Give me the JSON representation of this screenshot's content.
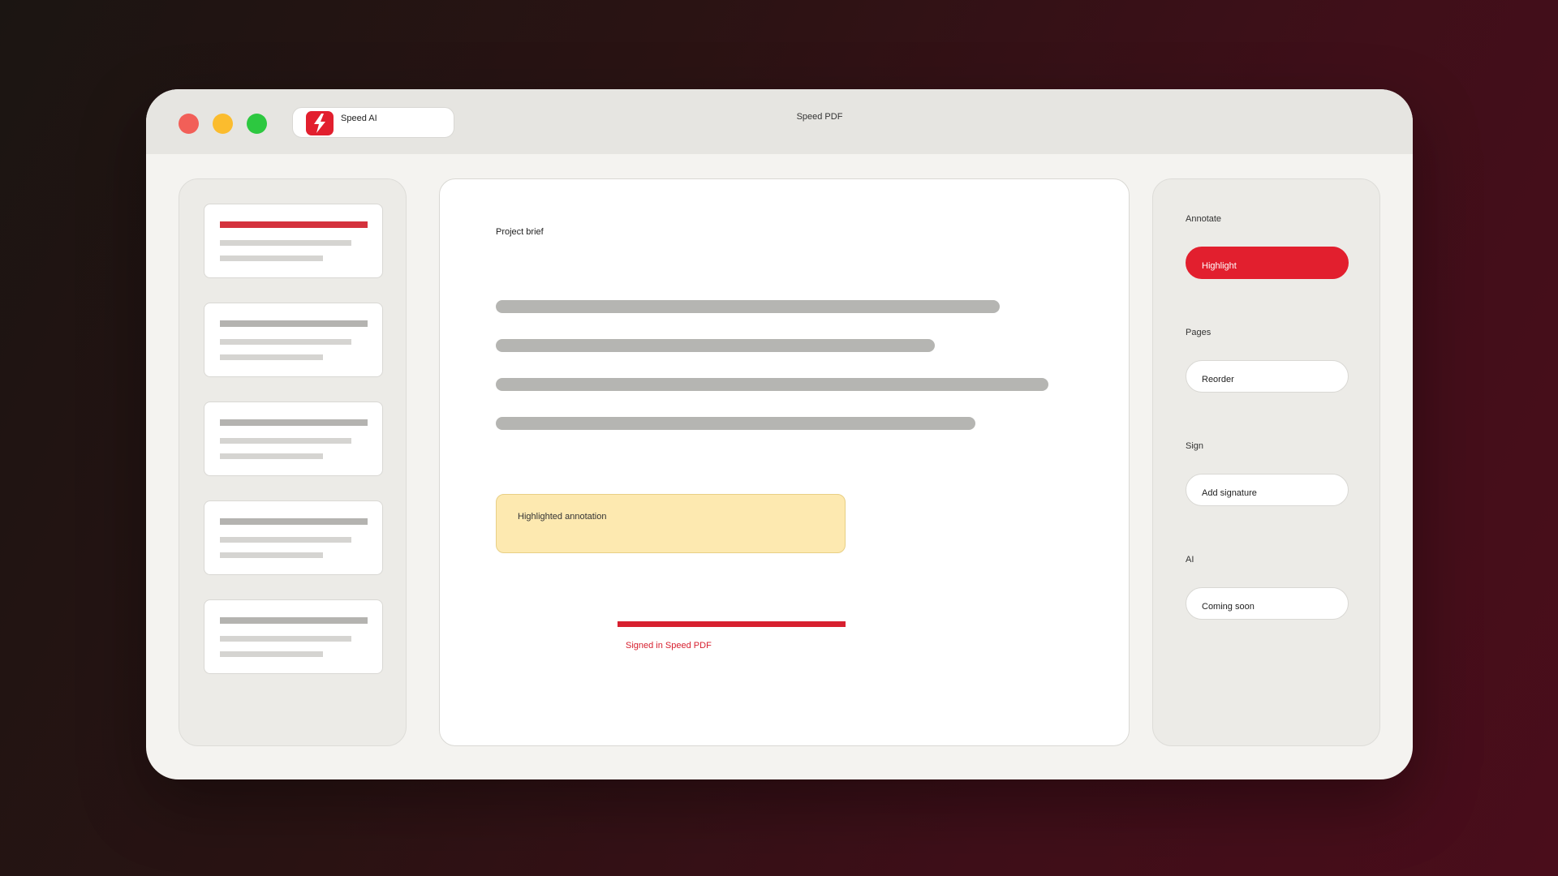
{
  "window": {
    "title": "Speed PDF",
    "app_tab_label": "Speed AI",
    "app_logo_icon": "speed-lightning-logo",
    "brand_color": "#e21f2e"
  },
  "sidebar": {
    "thumbnails": [
      {
        "active": true
      },
      {
        "active": false
      },
      {
        "active": false
      },
      {
        "active": false
      },
      {
        "active": false
      }
    ]
  },
  "document": {
    "title": "Project brief",
    "annotation_text": "Highlighted annotation",
    "signature_text": "Signed in Speed PDF"
  },
  "tools": {
    "annotate": {
      "label": "Annotate",
      "button": "Highlight"
    },
    "pages": {
      "label": "Pages",
      "button": "Reorder"
    },
    "sign": {
      "label": "Sign",
      "button": "Add signature"
    },
    "ai": {
      "label": "AI",
      "button": "Coming soon"
    }
  }
}
